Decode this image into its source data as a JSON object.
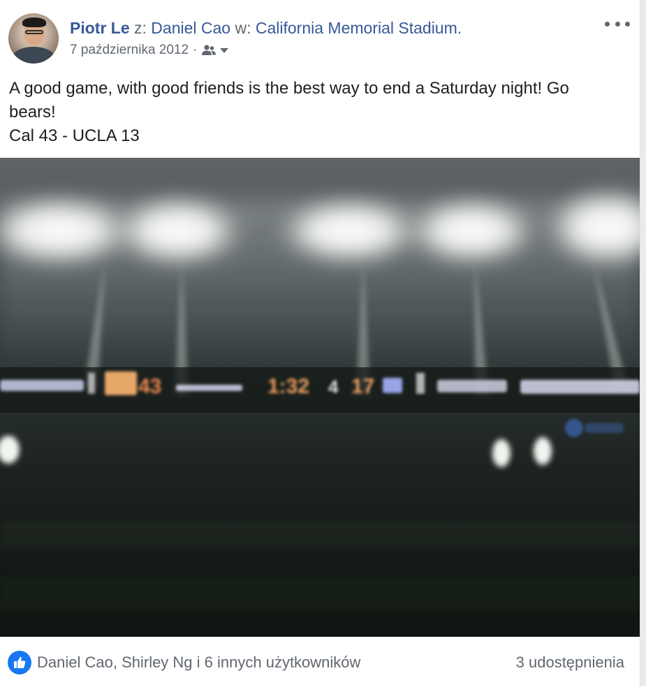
{
  "header": {
    "author": "Piotr Le",
    "with_word": "z:",
    "tagged": "Daniel Cao",
    "at_word": "w:",
    "location": "California Memorial Stadium.",
    "date": "7 października 2012",
    "separator": "·",
    "audience_icon": "friends-icon",
    "more_icon": "ellipsis-icon"
  },
  "post": {
    "lines": [
      "A good game, with good friends is the best way to end a Saturday night! Go",
      "bears!",
      "Cal 43 - UCLA 13"
    ]
  },
  "scoreboard": {
    "home_score": "43",
    "clock": "1:32",
    "quarter_marker": "4",
    "down_marker": "17"
  },
  "footer": {
    "reaction_icon": "like-icon",
    "reactions": "Daniel Cao, Shirley Ng i 6 innych użytkowników",
    "shares": "3 udostępnienia"
  },
  "colors": {
    "link": "#385898",
    "meta": "#606770",
    "text": "#1c1e21",
    "like_blue": "#1877f2"
  }
}
